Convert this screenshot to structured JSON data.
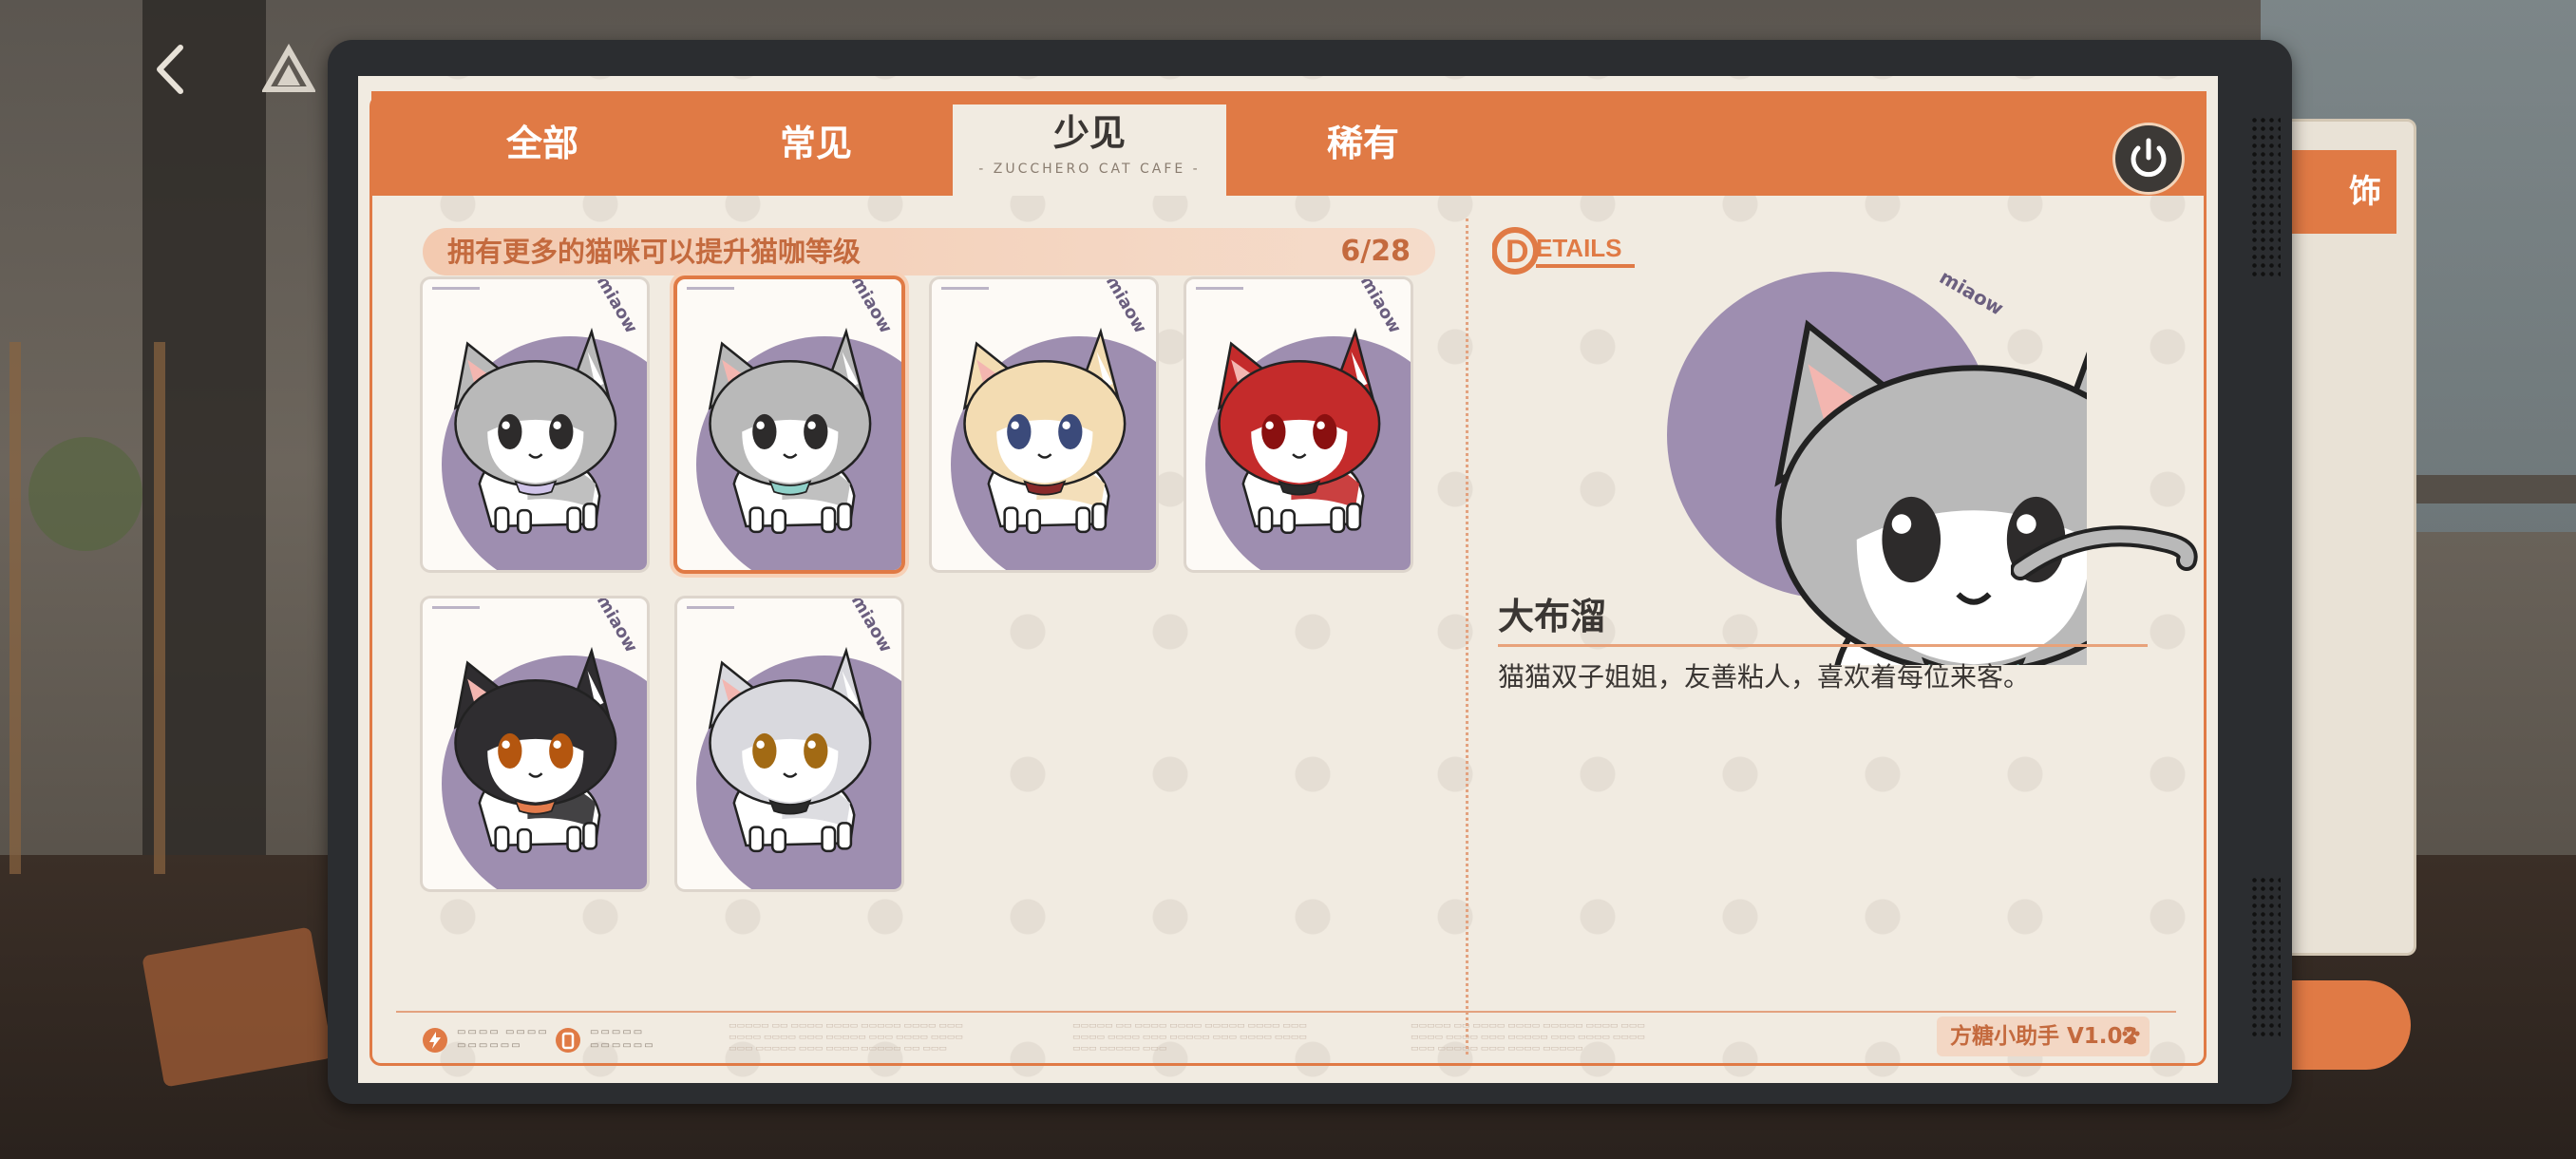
{
  "tabs": [
    {
      "label": "全部",
      "active": false
    },
    {
      "label": "常见",
      "active": false
    },
    {
      "label": "少见",
      "active": true,
      "sub": "- ZUCCHERO CAT CAFE -"
    },
    {
      "label": "稀有",
      "active": false
    }
  ],
  "collection": {
    "hint": "拥有更多的猫咪可以提升猫咖等级",
    "count": "6/28",
    "owned": 6,
    "total": 28
  },
  "cards": [
    {
      "id": "tabby-grey",
      "tag": "miaow",
      "selected": false,
      "fur": "#b9b9b9",
      "accent": "#cfc3e8",
      "eyes": "#2d2b2b"
    },
    {
      "id": "tabby-grey-bow",
      "tag": "miaow",
      "selected": true,
      "fur": "#b9b9b9",
      "accent": "#8fd0c8",
      "eyes": "#2d2b2b"
    },
    {
      "id": "cream",
      "tag": "miaow",
      "selected": false,
      "fur": "#f3dcb2",
      "accent": "#8a2a2a",
      "eyes": "#3b4a7a"
    },
    {
      "id": "red-hood",
      "tag": "miaow",
      "selected": false,
      "fur": "#c42b2b",
      "accent": "#2a2a2a",
      "eyes": "#8a1010"
    },
    {
      "id": "black",
      "tag": "miaow",
      "selected": false,
      "fur": "#2f2d30",
      "accent": "#e37b4c",
      "eyes": "#b4560f"
    },
    {
      "id": "white-silver",
      "tag": "miaow",
      "selected": false,
      "fur": "#d9d9de",
      "accent": "#2a2a2a",
      "eyes": "#a26a14"
    }
  ],
  "details": {
    "badge": "DETAILS",
    "tag": "miaow",
    "name": "大布溜",
    "description": "猫猫双子姐姐，友善粘人，喜欢着每位来客。"
  },
  "side_panel": {
    "tab_label": "饰"
  },
  "footer": {
    "version": "方糖小助手 V1.02"
  },
  "colors": {
    "accent": "#e07a45",
    "panel": "#f1ebe1",
    "frame": "#2b2d30",
    "lavender": "#9e8eb0"
  },
  "icons": [
    "back-arrow-icon",
    "brand-logo-icon",
    "power-icon",
    "paw-icon",
    "lightning-icon",
    "battery-icon"
  ]
}
